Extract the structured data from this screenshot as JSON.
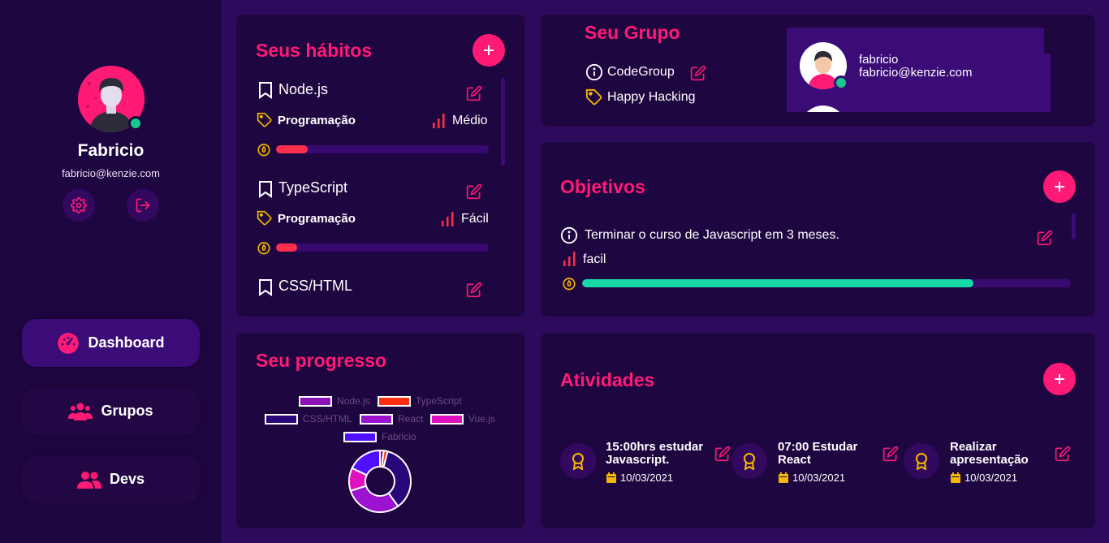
{
  "profile": {
    "name": "Fabricio",
    "email": "fabricio@kenzie.com"
  },
  "nav": {
    "dashboard": "Dashboard",
    "grupos": "Grupos",
    "devs": "Devs"
  },
  "habits": {
    "title": "Seus hábitos",
    "items": [
      {
        "name": "Node.js",
        "category": "Programação",
        "difficulty": "Médio",
        "progress": 0.15
      },
      {
        "name": "TypeScript",
        "category": "Programação",
        "difficulty": "Fácil",
        "progress": 0.1
      },
      {
        "name": "CSS/HTML"
      }
    ]
  },
  "group": {
    "title": "Seu Grupo",
    "name": "CodeGroup",
    "tag": "Happy Hacking",
    "member": {
      "name": "fabricio",
      "email": "fabricio@kenzie.com"
    }
  },
  "goals": {
    "title": "Objetivos",
    "items": [
      {
        "text": "Terminar o curso de Javascript em 3 meses.",
        "difficulty": "facil",
        "progress": 0.8
      }
    ]
  },
  "progress": {
    "title": "Seu progresso"
  },
  "chart_data": {
    "type": "pie",
    "legend": [
      "Node.js",
      "TypeScript",
      "CSS/HTML",
      "React",
      "Vue.js",
      "Fabricio"
    ],
    "colors": [
      "#8a12b8",
      "#ff2e12",
      "#28077a",
      "#9b12d0",
      "#e010c0",
      "#5010ff"
    ],
    "values": [
      2,
      2,
      36,
      30,
      12,
      18
    ]
  },
  "activities": {
    "title": "Atividades",
    "items": [
      {
        "title": "15:00hrs estudar Javascript.",
        "date": "10/03/2021"
      },
      {
        "title": "07:00 Estudar React",
        "date": "10/03/2021"
      },
      {
        "title": "Realizar apresentação",
        "date": "10/03/2021"
      }
    ]
  },
  "colors": {
    "accent": "#ff1a75",
    "success": "#17c98e",
    "background": "#2e0a5c",
    "card": "#1e0640",
    "icon_gold": "#f5b800"
  }
}
